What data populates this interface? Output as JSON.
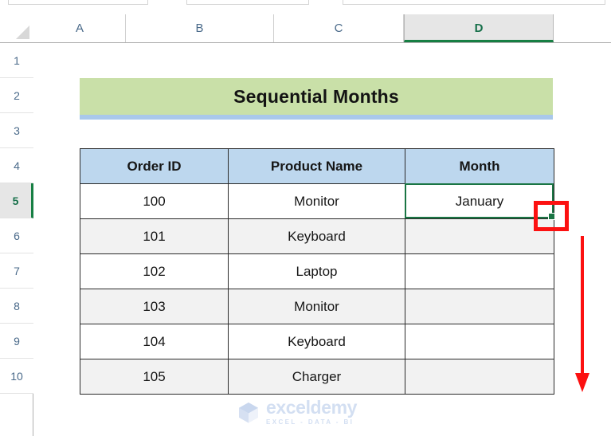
{
  "app": {
    "type": "spreadsheet",
    "accent_green": "#167f43",
    "annotation_red": "#fc1111"
  },
  "columns": {
    "headers": [
      {
        "label": "A",
        "selected": false
      },
      {
        "label": "B",
        "selected": false
      },
      {
        "label": "C",
        "selected": false
      },
      {
        "label": "D",
        "selected": true
      }
    ]
  },
  "rows": {
    "headers": [
      {
        "label": "1",
        "selected": false
      },
      {
        "label": "2",
        "selected": false
      },
      {
        "label": "3",
        "selected": false
      },
      {
        "label": "4",
        "selected": false
      },
      {
        "label": "5",
        "selected": true
      },
      {
        "label": "6",
        "selected": false
      },
      {
        "label": "7",
        "selected": false
      },
      {
        "label": "8",
        "selected": false
      },
      {
        "label": "9",
        "selected": false
      },
      {
        "label": "10",
        "selected": false
      }
    ]
  },
  "banner": {
    "title": "Sequential Months",
    "fill_color": "#c9e0a8",
    "underline_color": "#a9c8ea"
  },
  "table": {
    "header_fill": "#bdd7ee",
    "headers": [
      "Order ID",
      "Product Name",
      "Month"
    ],
    "rows": [
      {
        "order_id": "100",
        "product": "Monitor",
        "month": "January",
        "banded": false
      },
      {
        "order_id": "101",
        "product": "Keyboard",
        "month": "",
        "banded": true
      },
      {
        "order_id": "102",
        "product": "Laptop",
        "month": "",
        "banded": false
      },
      {
        "order_id": "103",
        "product": "Monitor",
        "month": "",
        "banded": true
      },
      {
        "order_id": "104",
        "product": "Keyboard",
        "month": "",
        "banded": false
      },
      {
        "order_id": "105",
        "product": "Charger",
        "month": "",
        "banded": true
      }
    ]
  },
  "selection": {
    "active_cell": "D5",
    "value": "January",
    "border_color": "#1a7544",
    "fill_handle_color": "#1a7544"
  },
  "annotations": {
    "box_label": "fill-handle-highlight",
    "arrow_label": "drag-down-arrow",
    "color": "#fc1111"
  },
  "watermark": {
    "name": "exceldemy",
    "tagline": "EXCEL - DATA - BI",
    "color": "#d3dff2"
  }
}
